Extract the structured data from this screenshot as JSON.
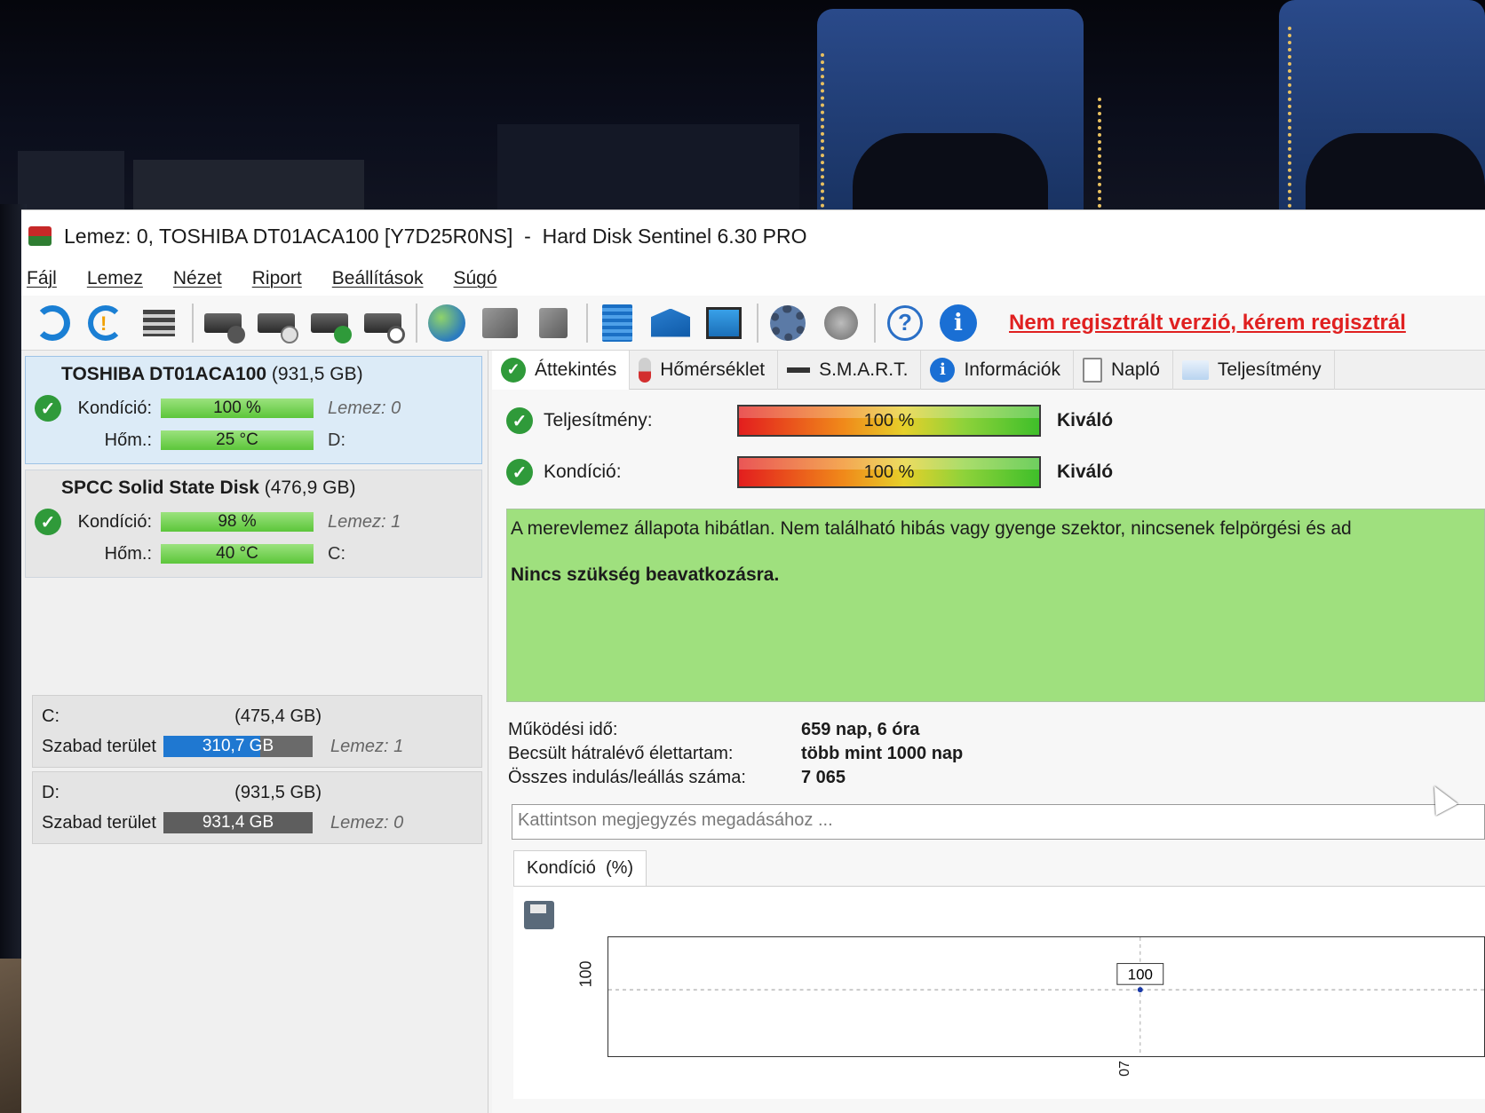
{
  "window": {
    "title": "Lemez: 0, TOSHIBA DT01ACA100 [Y7D25R0NS]  -  Hard Disk Sentinel 6.30 PRO"
  },
  "menu": [
    "Fájl",
    "Lemez",
    "Nézet",
    "Riport",
    "Beállítások",
    "Súgó"
  ],
  "toolbar": {
    "icons": [
      "refresh-icon",
      "refresh-warning-icon",
      "disk-list-icon",
      "disk-test-icon",
      "disk-schedule-icon",
      "disk-ok-icon",
      "disk-search-icon",
      "globe-icon",
      "network-icon",
      "usb-disk-icon",
      "report-icon",
      "mail-icon",
      "computer-icon",
      "settings-gear-icon",
      "sound-icon",
      "help-icon",
      "info-icon"
    ],
    "register_link": "Nem regisztrált verzió, kérem regisztrál"
  },
  "disks": [
    {
      "name": "TOSHIBA DT01ACA100",
      "size": "(931,5 GB)",
      "condition_label": "Kondíció:",
      "condition": "100 %",
      "temp_label": "Hőm.:",
      "temp": "25 °C",
      "lemez": "Lemez: 0",
      "letter": "D:"
    },
    {
      "name": "SPCC Solid State Disk",
      "size": "(476,9 GB)",
      "condition_label": "Kondíció:",
      "condition": "98 %",
      "temp_label": "Hőm.:",
      "temp": "40 °C",
      "lemez": "Lemez: 1",
      "letter": "C:"
    }
  ],
  "volumes": [
    {
      "letter": "C:",
      "size": "(475,4 GB)",
      "free_label": "Szabad terület",
      "free": "310,7 GB",
      "free_fraction": 0.65,
      "lemez": "Lemez: 1"
    },
    {
      "letter": "D:",
      "size": "(931,5 GB)",
      "free_label": "Szabad terület",
      "free": "931,4 GB",
      "free_fraction": 1.0,
      "lemez": "Lemez: 0"
    }
  ],
  "tabs": [
    "Áttekintés",
    "Hőmérséklet",
    "S.M.A.R.T.",
    "Információk",
    "Napló",
    "Teljesítmény"
  ],
  "status": {
    "performance_label": "Teljesítmény:",
    "performance_value": "100 %",
    "performance_grade": "Kiváló",
    "condition_label": "Kondíció:",
    "condition_value": "100 %",
    "condition_grade": "Kiváló"
  },
  "summary": {
    "text": "A merevlemez állapota hibátlan. Nem található hibás vagy gyenge szektor, nincsenek felpörgési és ad",
    "advice": "Nincs szükség beavatkozásra."
  },
  "stats": [
    {
      "label": "Működési idő:",
      "value": "659 nap, 6 óra"
    },
    {
      "label": "Becsült hátralévő élettartam:",
      "value": "több mint 1000 nap"
    },
    {
      "label": "Összes indulás/leállás száma:",
      "value": "7 065"
    }
  ],
  "note_placeholder": "Kattintson megjegyzés megadásához ...",
  "chart_tab": "Kondíció  (%)",
  "chart_data": {
    "type": "line",
    "title": "Kondíció  (%)",
    "xlabel": "",
    "ylabel": "",
    "y_ticks": [
      "100",
      "07"
    ],
    "series": [
      {
        "values": [
          100
        ]
      }
    ],
    "point_labels": [
      "100"
    ]
  }
}
